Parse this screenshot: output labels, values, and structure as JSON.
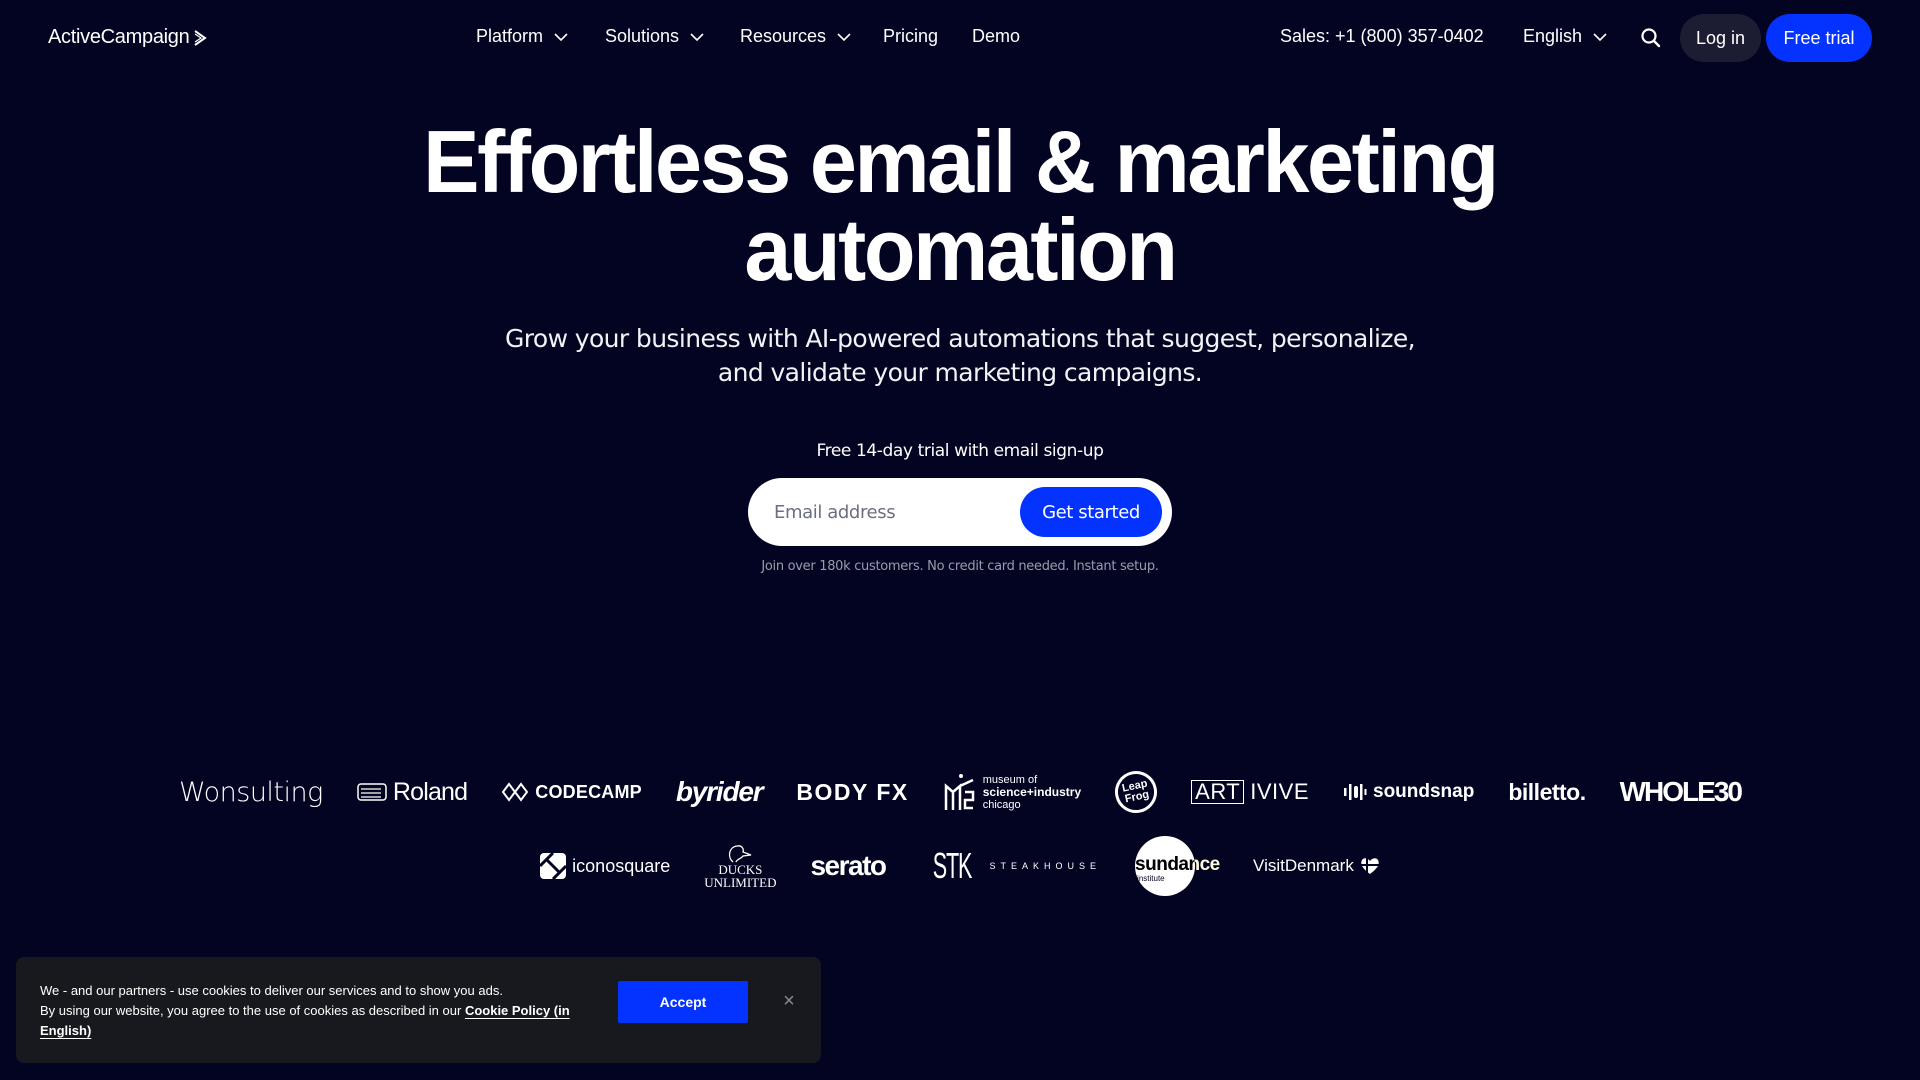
{
  "nav": {
    "logo": "ActiveCampaign",
    "logo_mark": ">",
    "items": [
      {
        "label": "Platform",
        "dropdown": true
      },
      {
        "label": "Solutions",
        "dropdown": true
      },
      {
        "label": "Resources",
        "dropdown": true
      },
      {
        "label": "Pricing",
        "dropdown": false
      },
      {
        "label": "Demo",
        "dropdown": false
      }
    ],
    "sales": "Sales: +1 (800) 357-0402",
    "language": "English",
    "search_icon": "search-icon",
    "login": "Log in",
    "free_trial": "Free trial"
  },
  "hero": {
    "headline_line1": "Effortless email & marketing",
    "headline_line2": "automation",
    "sub_line1": "Grow your business with AI-powered automations that suggest, personalize,",
    "sub_line2": "and validate your marketing campaigns.",
    "trial_note": "Free 14-day trial with email sign-up",
    "email_placeholder": "Email address",
    "email_value": "",
    "cta": "Get started",
    "fineprint": "Join over 180k customers. No credit card needed. Instant setup."
  },
  "logos": {
    "row1": [
      "Wonsulting",
      "Roland",
      "CodeCamp",
      "byrider",
      "BODY FX",
      "museum of science+industry chicago",
      "LeapFrog",
      "ARTIVIVE",
      "soundsnap",
      "billetto.",
      "WHOLE30"
    ],
    "row2": [
      "iconosquare",
      "Ducks Unlimited",
      "serato",
      "STK Steakhouse",
      "sundance institute",
      "VisitDenmark"
    ]
  },
  "cookie": {
    "line1": "We - and our partners - use cookies to deliver our services and to show you ads.",
    "line2": "By using our website, you agree to the use of cookies as described in our",
    "link": "Cookie Policy (in English)",
    "accept": "Accept",
    "close": "×"
  },
  "colors": {
    "background": "#020422",
    "accent": "#0433ff",
    "login_bg": "#1c1d33",
    "cookie_bg": "#18191f"
  }
}
